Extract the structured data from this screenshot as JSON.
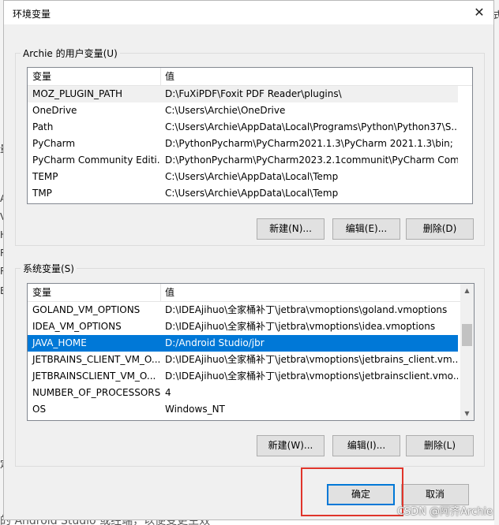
{
  "dialog": {
    "title": "环境变量",
    "close_glyph": "✕"
  },
  "user_vars": {
    "group_label": "Archie 的用户变量(U)",
    "col_name": "变量",
    "col_value": "值",
    "rows": [
      {
        "name": "MOZ_PLUGIN_PATH",
        "value": "D:\\FuXiPDF\\Foxit PDF Reader\\plugins\\"
      },
      {
        "name": "OneDrive",
        "value": "C:\\Users\\Archie\\OneDrive"
      },
      {
        "name": "Path",
        "value": "C:\\Users\\Archie\\AppData\\Local\\Programs\\Python\\Python37\\S..."
      },
      {
        "name": "PyCharm",
        "value": "D:\\PythonPycharm\\PyCharm2021.1.3\\PyCharm 2021.1.3\\bin;"
      },
      {
        "name": "PyCharm Community Editi...",
        "value": "D:\\PythonPycharm\\PyCharm2023.2.1communit\\PyCharm Com..."
      },
      {
        "name": "TEMP",
        "value": "C:\\Users\\Archie\\AppData\\Local\\Temp"
      },
      {
        "name": "TMP",
        "value": "C:\\Users\\Archie\\AppData\\Local\\Temp"
      }
    ],
    "new_label": "新建(N)...",
    "edit_label": "编辑(E)...",
    "delete_label": "删除(D)"
  },
  "system_vars": {
    "group_label": "系统变量(S)",
    "col_name": "变量",
    "col_value": "值",
    "rows": [
      {
        "name": "GOLAND_VM_OPTIONS",
        "value": "D:\\IDEAjihuo\\全家桶补丁\\jetbra\\vmoptions\\goland.vmoptions"
      },
      {
        "name": "IDEA_VM_OPTIONS",
        "value": "D:\\IDEAjihuo\\全家桶补丁\\jetbra\\vmoptions\\idea.vmoptions"
      },
      {
        "name": "JAVA_HOME",
        "value": "D:/Android Studio/jbr"
      },
      {
        "name": "JETBRAINS_CLIENT_VM_O...",
        "value": "D:\\IDEAjihuo\\全家桶补丁\\jetbra\\vmoptions\\jetbrains_client.vm..."
      },
      {
        "name": "JETBRAINSCLIENT_VM_O...",
        "value": "D:\\IDEAjihuo\\全家桶补丁\\jetbra\\vmoptions\\jetbrainsclient.vmo..."
      },
      {
        "name": "NUMBER_OF_PROCESSORS",
        "value": "4"
      },
      {
        "name": "OS",
        "value": "Windows_NT"
      }
    ],
    "selected_index": 2,
    "new_label": "新建(W)...",
    "edit_label": "编辑(I)...",
    "delete_label": "删除(L)",
    "scroll_up_glyph": "▲",
    "scroll_down_glyph": "▼"
  },
  "footer": {
    "ok_label": "确定",
    "cancel_label": "取消"
  },
  "background": {
    "side_chars": [
      "A",
      "V",
      "H",
      "R",
      "R",
      "B"
    ],
    "top_char": "量",
    "right_char": "式",
    "bottom_left_char": "定",
    "bottom_text": "的 Android Studio 或经端，以便变更生效"
  },
  "watermark": "CSDN @阿齐Archie",
  "colors": {
    "selection": "#0078d7",
    "highlight_box": "#e0352b"
  }
}
